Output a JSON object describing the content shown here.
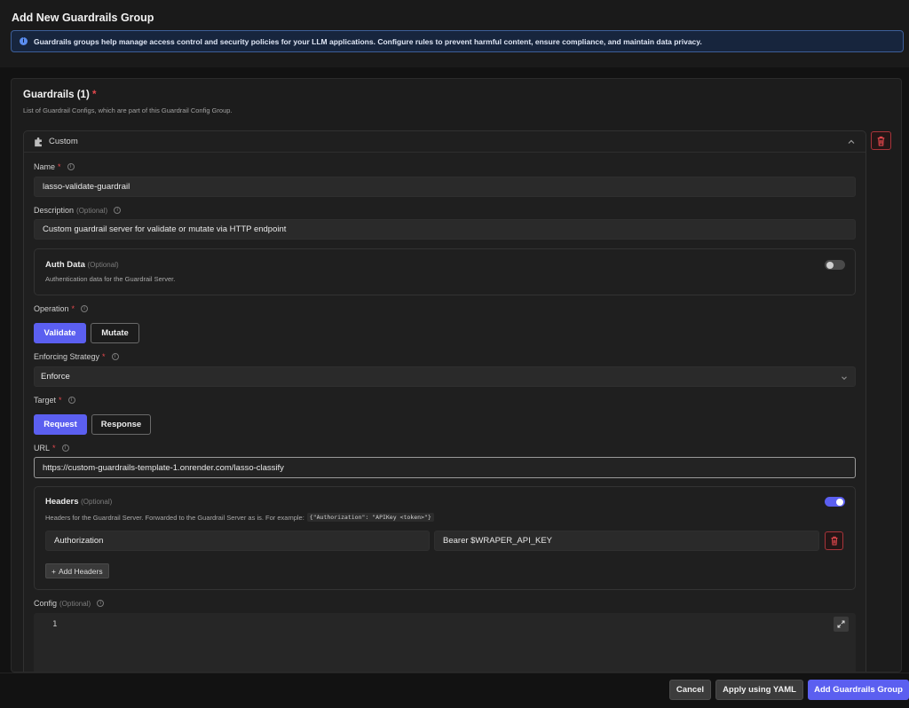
{
  "page": {
    "title": "Add New Guardrails Group",
    "info_banner": "Guardrails groups help manage access control and security policies for your LLM applications. Configure rules to prevent harmful content, ensure compliance, and maintain data privacy."
  },
  "guardrails_section": {
    "title": "Guardrails (1)",
    "required_mark": "*",
    "subtitle": "List of Guardrail Configs, which are part of this Guardrail Config Group."
  },
  "card": {
    "title": "Custom",
    "name": {
      "label": "Name",
      "value": "lasso-validate-guardrail"
    },
    "description": {
      "label": "Description",
      "optional": "(Optional)",
      "value": "Custom guardrail server for validate or mutate via HTTP endpoint"
    },
    "auth_data": {
      "title": "Auth Data",
      "optional": "(Optional)",
      "desc": "Authentication data for the Guardrail Server.",
      "enabled": false
    },
    "operation": {
      "label": "Operation",
      "options": [
        "Validate",
        "Mutate"
      ],
      "selected": "Validate"
    },
    "enforcing_strategy": {
      "label": "Enforcing Strategy",
      "value": "Enforce"
    },
    "target": {
      "label": "Target",
      "options": [
        "Request",
        "Response"
      ],
      "selected": "Request"
    },
    "url": {
      "label": "URL",
      "value": "https://custom-guardrails-template-1.onrender.com/lasso-classify"
    },
    "headers": {
      "title": "Headers",
      "optional": "(Optional)",
      "desc": "Headers for the Guardrail Server. Forwarded to the Guardrail Server as is. For example:",
      "example": "{\"Authorization\": \"APIKey <token>\"}",
      "enabled": true,
      "rows": [
        {
          "key": "Authorization",
          "value": "Bearer $WRAPER_API_KEY"
        }
      ],
      "add_label": "Add Headers"
    },
    "config": {
      "label": "Config",
      "optional": "(Optional)",
      "line_number": "1"
    }
  },
  "footer": {
    "cancel": "Cancel",
    "apply_yaml": "Apply using YAML",
    "add_group": "Add Guardrails Group"
  },
  "colors": {
    "accent": "#5b5ff0",
    "danger": "#e5484d",
    "info": "#5b8def"
  }
}
